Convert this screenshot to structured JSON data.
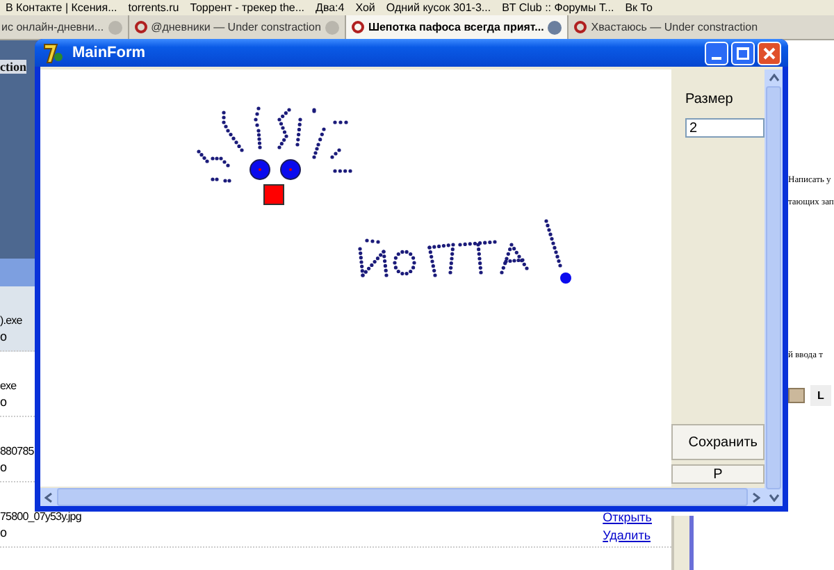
{
  "browser": {
    "bookmarks": [
      "В Контакте | Ксения...",
      "torrents.ru",
      "Торрент - трекер the...",
      "Два:4",
      "Хой",
      "Одний кусок 301-3...",
      "BT Club :: Форумы T...",
      "Вк То"
    ],
    "tabs": [
      {
        "label": "ис онлайн-дневни...",
        "selected": false
      },
      {
        "label": "@дневники — Under constraction",
        "selected": false
      },
      {
        "label": "Шепотка пафоса всегда прият...",
        "selected": true
      },
      {
        "label": "Хвастаюсь — Under constraction",
        "selected": false
      }
    ],
    "page": {
      "header_fragment": "ction",
      "files": [
        {
          "name": ").exe",
          "status": "o"
        },
        {
          "name": "exe",
          "status": "o"
        },
        {
          "name": "880785",
          "status": "o"
        },
        {
          "name": "75800_07y53y.jpg",
          "status": "o"
        }
      ],
      "links": [
        "Открыть",
        "Удалить"
      ],
      "right_fragments": [
        "Написать у",
        "тающих зап",
        "й ввода т"
      ],
      "toolbar_letter": "L"
    }
  },
  "window": {
    "title": "MainForm",
    "size_label": "Размер",
    "size_value": "2",
    "buttons": [
      "Сохранить",
      "Р"
    ]
  }
}
